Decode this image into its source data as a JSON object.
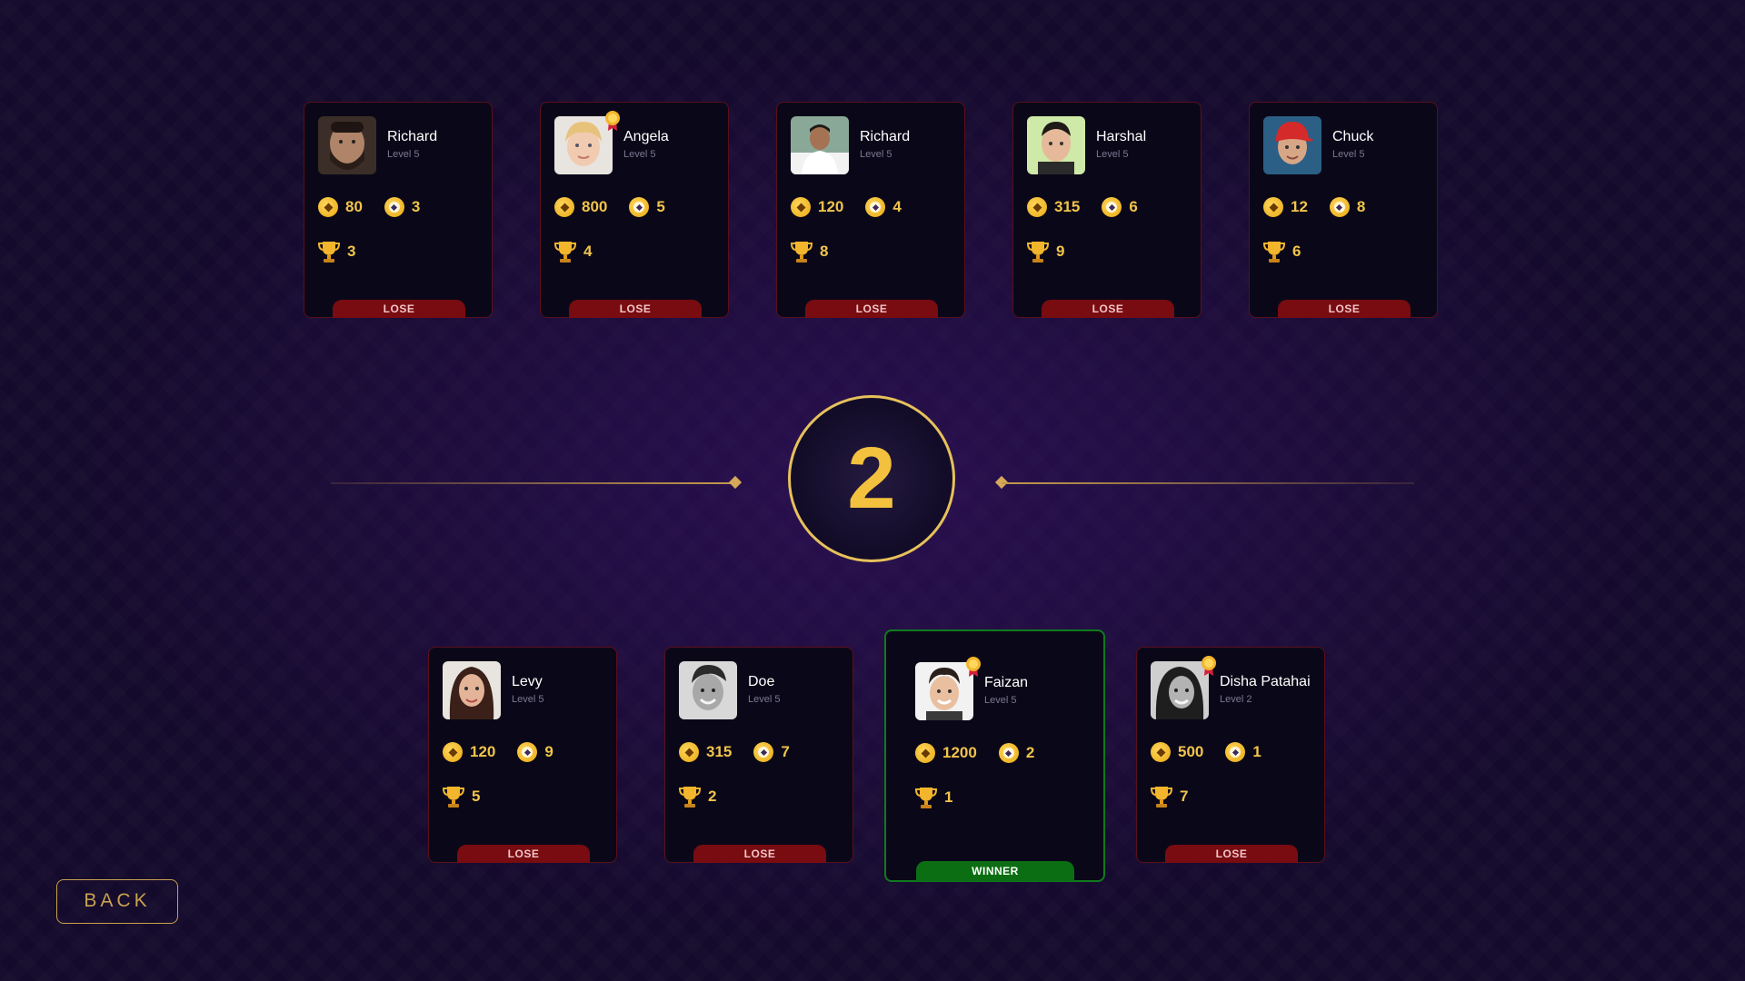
{
  "round": {
    "number": "2"
  },
  "back_button": {
    "label": "BACK"
  },
  "top_players": [
    {
      "name": "Richard",
      "level": "Level 5",
      "coins": "80",
      "gems": "3",
      "trophies": "3",
      "result": "LOSE",
      "medal": false,
      "avatar": "bearded-man-avatar"
    },
    {
      "name": "Angela",
      "level": "Level 5",
      "coins": "800",
      "gems": "5",
      "trophies": "4",
      "result": "LOSE",
      "medal": true,
      "avatar": "blonde-child-avatar"
    },
    {
      "name": "Richard",
      "level": "Level 5",
      "coins": "120",
      "gems": "4",
      "trophies": "8",
      "result": "LOSE",
      "medal": false,
      "avatar": "man-white-shirt-avatar"
    },
    {
      "name": "Harshal",
      "level": "Level 5",
      "coins": "315",
      "gems": "6",
      "trophies": "9",
      "result": "LOSE",
      "medal": false,
      "avatar": "man-green-bg-avatar"
    },
    {
      "name": "Chuck",
      "level": "Level 5",
      "coins": "12",
      "gems": "8",
      "trophies": "6",
      "result": "LOSE",
      "medal": false,
      "avatar": "man-red-cap-avatar"
    }
  ],
  "bottom_players": [
    {
      "name": "Levy",
      "level": "Level 5",
      "coins": "120",
      "gems": "9",
      "trophies": "5",
      "result": "LOSE",
      "medal": false,
      "avatar": "woman-dark-hair-avatar"
    },
    {
      "name": "Doe",
      "level": "Level 5",
      "coins": "315",
      "gems": "7",
      "trophies": "2",
      "result": "LOSE",
      "medal": false,
      "avatar": "man-bw-photo-avatar"
    },
    {
      "name": "Faizan",
      "level": "Level 5",
      "coins": "1200",
      "gems": "2",
      "trophies": "1",
      "result": "WINNER",
      "medal": true,
      "avatar": "young-man-avatar"
    },
    {
      "name": "Disha Patahai",
      "level": "Level 2",
      "coins": "500",
      "gems": "1",
      "trophies": "7",
      "result": "LOSE",
      "medal": true,
      "avatar": "woman-bw-photo-avatar"
    }
  ],
  "colors": {
    "accent_gold": "#f2c44b",
    "lose_red": "#780c10",
    "winner_green": "#0b6e12"
  }
}
